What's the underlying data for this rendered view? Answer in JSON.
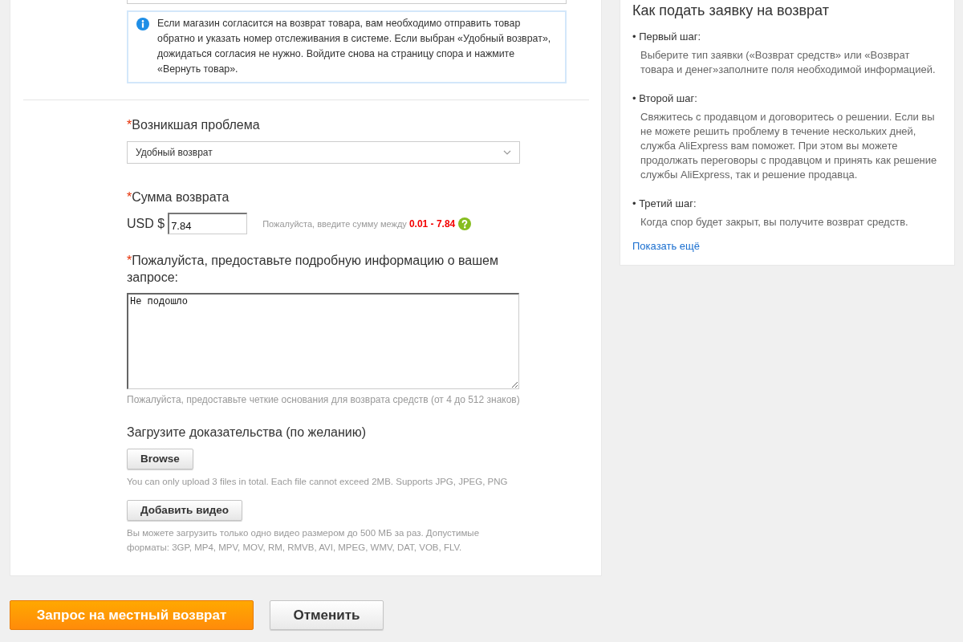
{
  "notice": {
    "text": "Если магазин согласится на возврат товара, вам необходимо отправить товар обратно и указать номер отслеживания в системе. Если выбран «Удобный возврат», дожидаться согласия не нужно. Войдите снова на страницу спора и нажмите «Вернуть товар»."
  },
  "form": {
    "problem": {
      "required_mark": "*",
      "label": "Возникшая проблема",
      "value": "Удобный возврат"
    },
    "amount": {
      "required_mark": "*",
      "label": "Сумма возврата",
      "currency": "USD $",
      "value": "7.84",
      "hint": "Пожалуйста, введите сумму между **0.01 - 7.84**"
    },
    "details": {
      "required_mark": "*",
      "label": "Пожалуйста, предоставьте подробную информацию о вашем запросе:",
      "value": "Не подошло",
      "hint": "Пожалуйста, предоставьте четкие основания для возврата средств (от 4 до 512 знаков)"
    },
    "evidence": {
      "label": "Загрузите доказательства (по желанию)",
      "uploads": [
        {
          "button": "Browse",
          "hint": "You can only upload 3 files in total. Each file cannot exceed 2MB. Supports JPG, JPEG, PNG"
        },
        {
          "button": "Добавить видео",
          "hint": "Вы можете загрузить только одно видео размером до 500 МБ за раз. Допустимые форматы: 3GP, MP4, MPV, MOV, RM, RMVB, AVI, MPEG, WMV, DAT, VOB, FLV."
        }
      ]
    }
  },
  "actions": [
    {
      "kind": "primary",
      "label": "Запрос на местный возврат"
    },
    {
      "kind": "secondary",
      "label": "Отменить"
    }
  ],
  "help": {
    "title": "Как подать заявку на возврат",
    "steps": [
      {
        "title": "• Первый шаг:",
        "text": "Выберите тип заявки («Возврат средств» или «Возврат товара и денег»заполните поля необходимой информацией."
      },
      {
        "title": "• Второй шаг:",
        "text": "Свяжитесь с продавцом и договоритесь о решении. Если вы не можете решить проблему в течение нескольких дней, служба AliExpress вам поможет. При этом вы можете продолжать переговоры с продавцом и принять как решение службы AliExpress, так и решение продавца."
      },
      {
        "title": "• Третий шаг:",
        "text": "Когда спор будет закрыт, вы получите возврат средств."
      }
    ],
    "link": "Показать ещё"
  }
}
